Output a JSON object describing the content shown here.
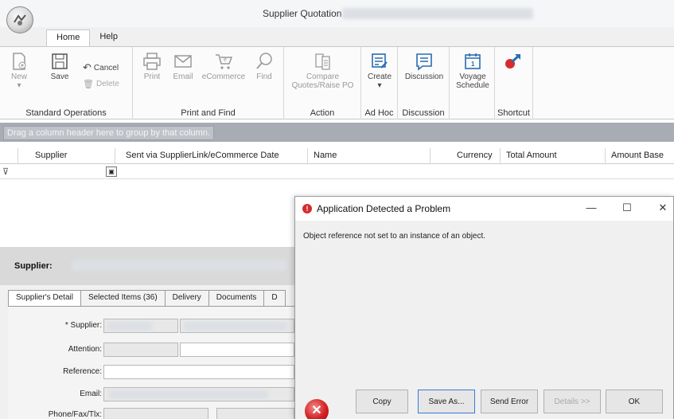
{
  "window": {
    "title": "Supplier Quotation"
  },
  "ribbon_tabs": [
    "Home",
    "Help"
  ],
  "ribbon": {
    "standard": {
      "label": "Standard Operations",
      "new": "New",
      "save": "Save",
      "cancel": "Cancel",
      "delete": "Delete"
    },
    "print_find": {
      "label": "Print and Find",
      "print": "Print",
      "email": "Email",
      "ecommerce": "eCommerce",
      "find": "Find"
    },
    "action": {
      "label": "Action",
      "compare_1": "Compare",
      "compare_2": "Quotes/Raise PO"
    },
    "adhoc": {
      "label": "Ad Hoc",
      "create": "Create"
    },
    "discussion": {
      "label": "Discussion",
      "discussion": "Discussion"
    },
    "voyage": {
      "label_1": "Voyage",
      "label_2": "Schedule"
    },
    "shortcut": {
      "label": "Shortcut"
    }
  },
  "grid": {
    "group_hint": "Drag a column header here to group by that column.",
    "columns": [
      "Supplier",
      "Sent via SupplierLink/eCommerce Date",
      "Name",
      "Currency",
      "Total Amount",
      "Amount Base"
    ]
  },
  "supplier_section": {
    "label": "Supplier:",
    "tabs": [
      "Supplier's Detail",
      "Selected Items (36)",
      "Delivery",
      "Documents",
      "D"
    ],
    "fields": [
      "* Supplier:",
      "Attention:",
      "Reference:",
      "Email:",
      "Phone/Fax/Tlx:"
    ]
  },
  "dialog": {
    "title": "Application Detected a Problem",
    "message": "Object reference not set to an instance of an object.",
    "buttons": {
      "copy": "Copy",
      "save_as": "Save As...",
      "send_error": "Send Error",
      "details": "Details >>",
      "ok": "OK"
    }
  },
  "icons": {
    "accent": "#2b6cb0",
    "error": "#d32020",
    "shortcut_red": "#d62b2b"
  }
}
